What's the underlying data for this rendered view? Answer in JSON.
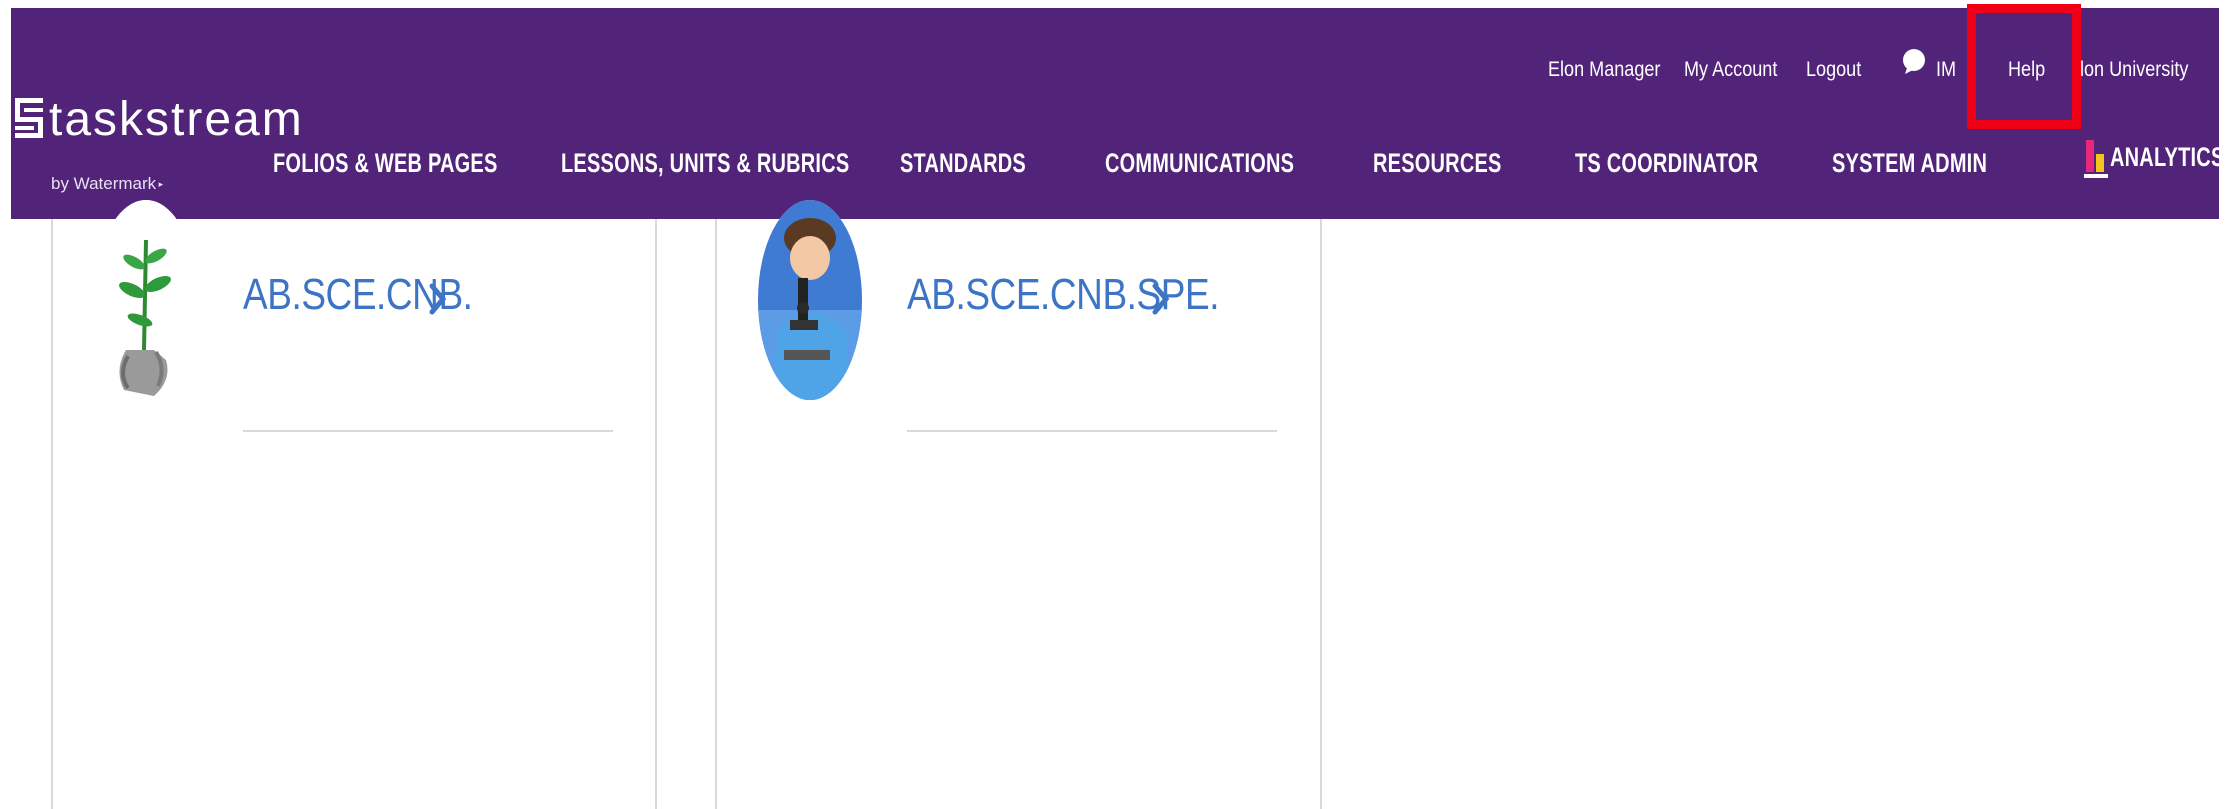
{
  "brand": {
    "name": "taskstream",
    "tagline": "by Watermark"
  },
  "utility_nav": {
    "user": "Elon Manager",
    "account": "My Account",
    "logout": "Logout",
    "chat_initials": "IM",
    "help": "Help",
    "institution": "lon University"
  },
  "main_nav": [
    "FOLIOS & WEB PAGES",
    "LESSONS, UNITS & RUBRICS",
    "STANDARDS",
    "COMMUNICATIONS",
    "RESOURCES",
    "TS COORDINATOR",
    "SYSTEM ADMIN",
    "ANALYTICS"
  ],
  "courses": [
    {
      "code": "AB.SCE.CNB.",
      "avatar": "plant-in-hand-image",
      "chevron": "chevron-right-icon"
    },
    {
      "code": "AB.SCE.CNB.SPE.",
      "avatar": "student-microscope-image",
      "chevron": "chevron-right-icon"
    }
  ],
  "colors": {
    "header": "#51247a",
    "link": "#3e74c5",
    "highlight": "#f00015",
    "divider": "#d9d9d9"
  }
}
